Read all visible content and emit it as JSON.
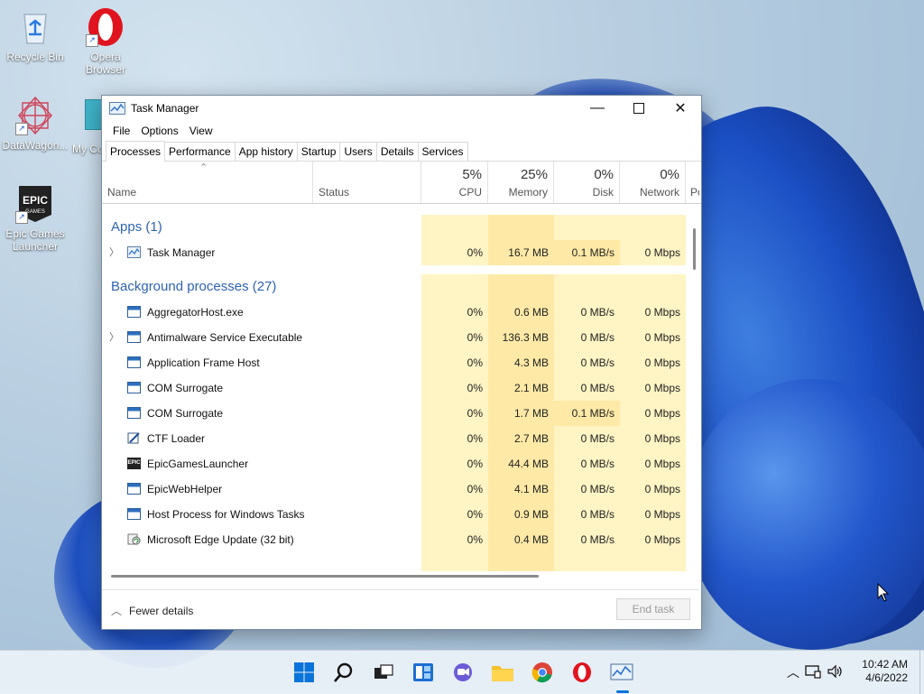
{
  "desktop": {
    "icons": [
      {
        "label": "Recycle Bin"
      },
      {
        "label": "Opera Browser"
      },
      {
        "label": "DataWagon..."
      },
      {
        "label": "My Co"
      },
      {
        "label": "Epic Games Launcher"
      }
    ]
  },
  "window": {
    "title": "Task Manager",
    "menu": [
      "File",
      "Options",
      "View"
    ],
    "tabs": [
      "Processes",
      "Performance",
      "App history",
      "Startup",
      "Users",
      "Details",
      "Services"
    ],
    "columns": {
      "name": "Name",
      "status": "Status",
      "cpu": {
        "pct": "5%",
        "label": "CPU"
      },
      "memory": {
        "pct": "25%",
        "label": "Memory"
      },
      "disk": {
        "pct": "0%",
        "label": "Disk"
      },
      "network": {
        "pct": "0%",
        "label": "Network"
      },
      "extra": "Po"
    },
    "groups": {
      "apps": "Apps (1)",
      "background": "Background processes (27)"
    },
    "apps": [
      {
        "name": "Task Manager",
        "cpu": "0%",
        "memory": "16.7 MB",
        "disk": "0.1 MB/s",
        "network": "0 Mbps"
      }
    ],
    "background": [
      {
        "name": "AggregatorHost.exe",
        "cpu": "0%",
        "memory": "0.6 MB",
        "disk": "0 MB/s",
        "network": "0 Mbps"
      },
      {
        "name": "Antimalware Service Executable",
        "cpu": "0%",
        "memory": "136.3 MB",
        "disk": "0 MB/s",
        "network": "0 Mbps"
      },
      {
        "name": "Application Frame Host",
        "cpu": "0%",
        "memory": "4.3 MB",
        "disk": "0 MB/s",
        "network": "0 Mbps"
      },
      {
        "name": "COM Surrogate",
        "cpu": "0%",
        "memory": "2.1 MB",
        "disk": "0 MB/s",
        "network": "0 Mbps"
      },
      {
        "name": "COM Surrogate",
        "cpu": "0%",
        "memory": "1.7 MB",
        "disk": "0.1 MB/s",
        "network": "0 Mbps"
      },
      {
        "name": "CTF Loader",
        "cpu": "0%",
        "memory": "2.7 MB",
        "disk": "0 MB/s",
        "network": "0 Mbps"
      },
      {
        "name": "EpicGamesLauncher",
        "cpu": "0%",
        "memory": "44.4 MB",
        "disk": "0 MB/s",
        "network": "0 Mbps"
      },
      {
        "name": "EpicWebHelper",
        "cpu": "0%",
        "memory": "4.1 MB",
        "disk": "0 MB/s",
        "network": "0 Mbps"
      },
      {
        "name": "Host Process for Windows Tasks",
        "cpu": "0%",
        "memory": "0.9 MB",
        "disk": "0 MB/s",
        "network": "0 Mbps"
      },
      {
        "name": "Microsoft Edge Update (32 bit)",
        "cpu": "0%",
        "memory": "0.4 MB",
        "disk": "0 MB/s",
        "network": "0 Mbps"
      }
    ],
    "footer": {
      "fewer_details": "Fewer details",
      "end_task": "End task"
    }
  },
  "taskbar": {
    "clock": {
      "time": "10:42 AM",
      "date": "4/6/2022"
    }
  },
  "colors": {
    "accent": "#2e63b4",
    "cell_light": "#fff4c4",
    "cell_strong": "#ffe9a6"
  }
}
